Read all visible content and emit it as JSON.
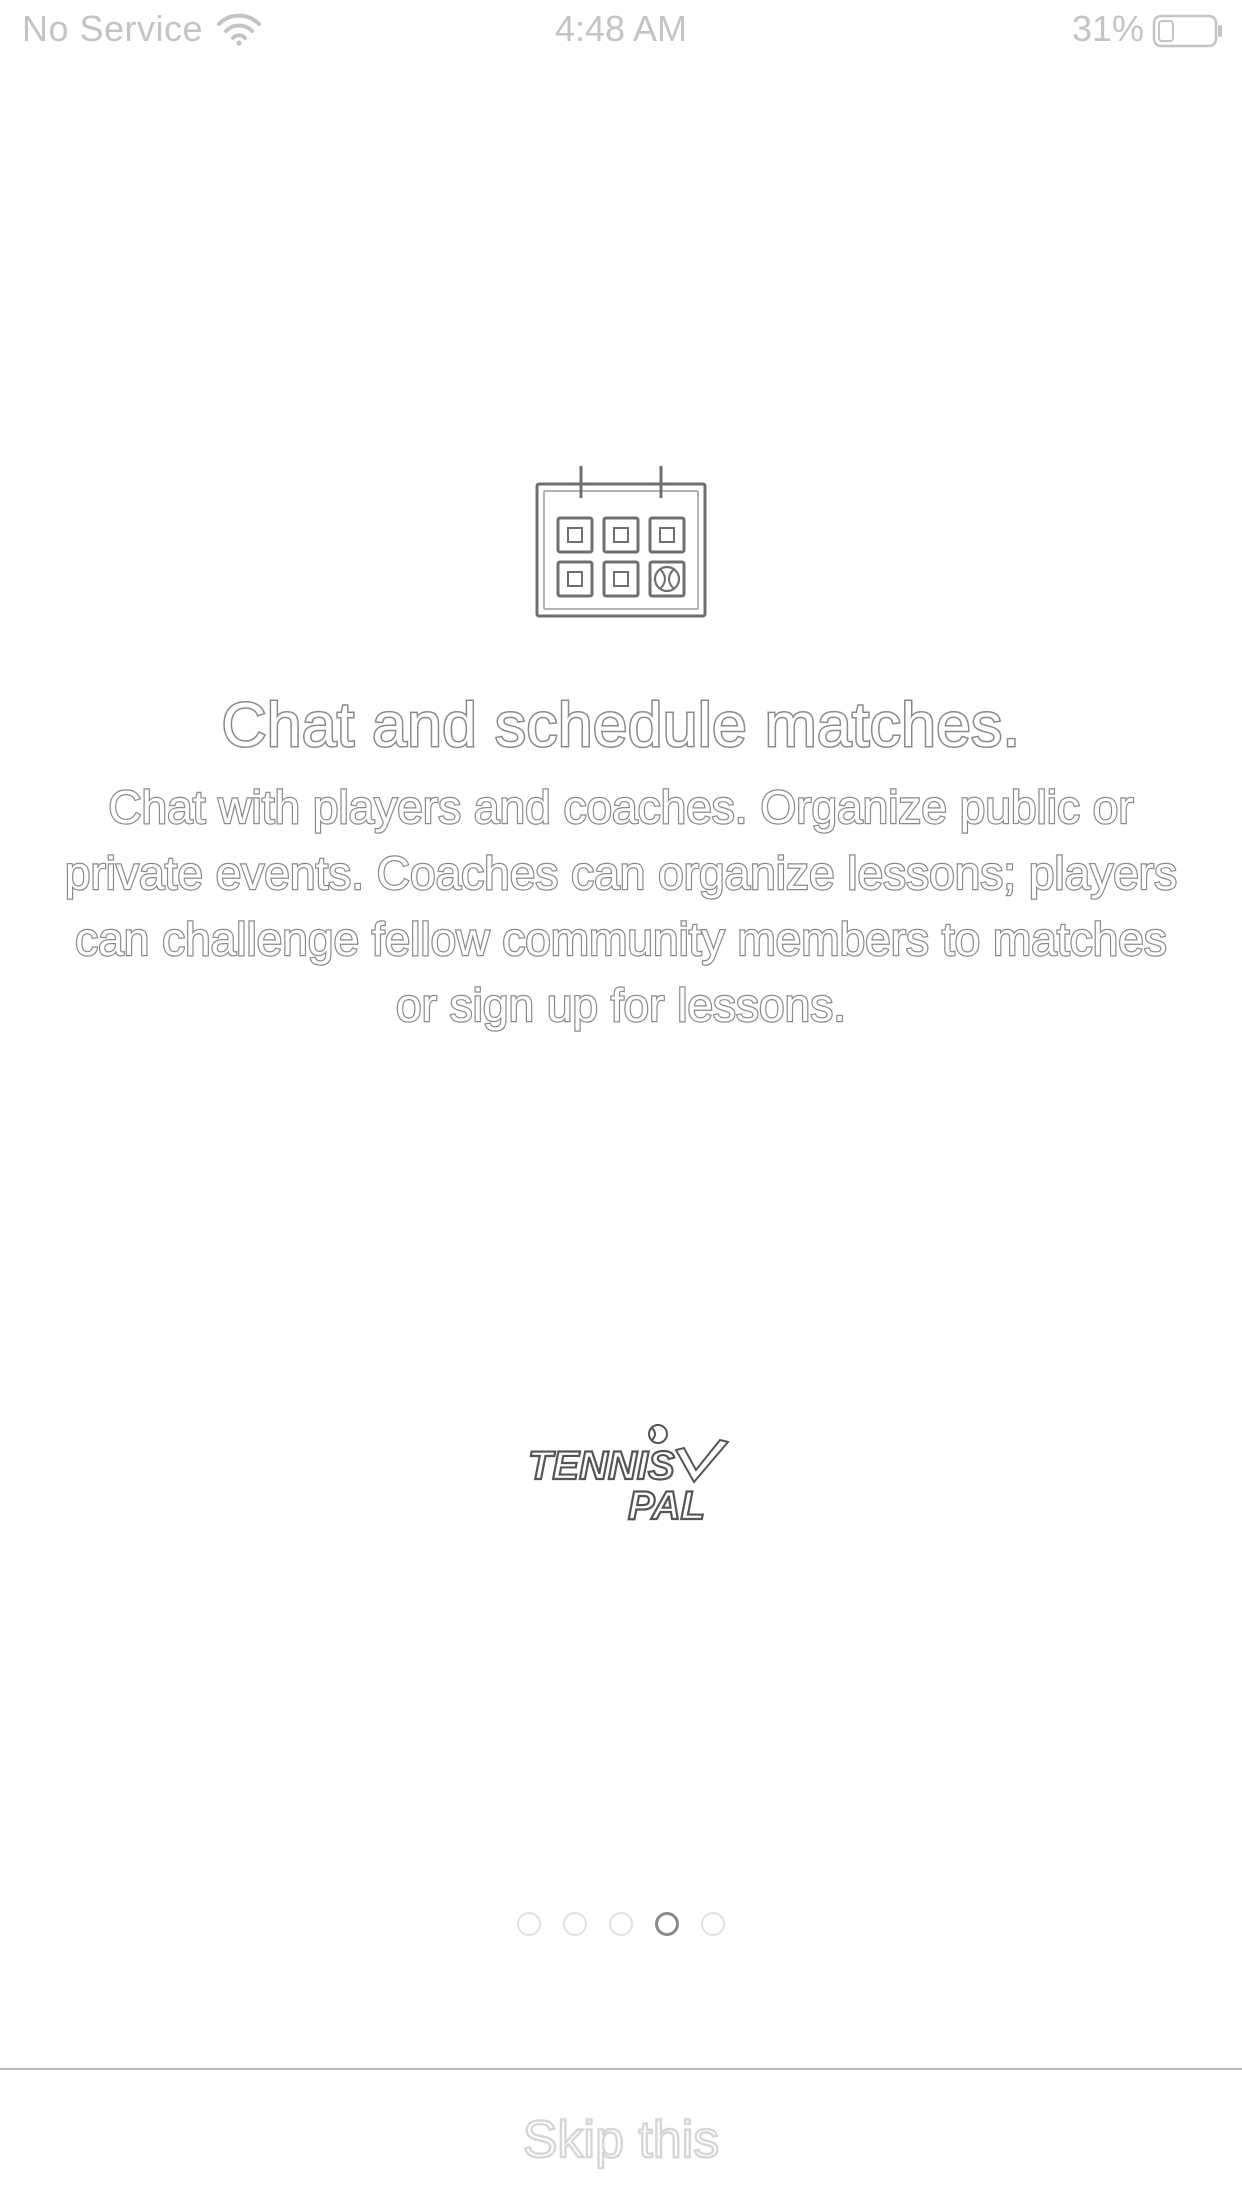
{
  "status_bar": {
    "carrier": "No Service",
    "time": "4:48 AM",
    "battery_percent": "31%",
    "battery_level": 0.31,
    "icons": [
      "wifi-icon",
      "battery-icon"
    ]
  },
  "slide": {
    "icon": "calendar-icon",
    "title": "Chat and schedule matches.",
    "body": "Chat with players and coaches. Organize public or private events. Coaches can organize lessons; players can challenge fellow community members to matches or sign up for lessons."
  },
  "logo": {
    "line1": "TENNIS",
    "line2": "PAL"
  },
  "pagination": {
    "total": 5,
    "current": 4
  },
  "footer": {
    "skip_label": "Skip this"
  },
  "colors": {
    "outline": "#8c8c8c",
    "status_text": "#c4c4c4",
    "divider": "#b9b9b9"
  }
}
